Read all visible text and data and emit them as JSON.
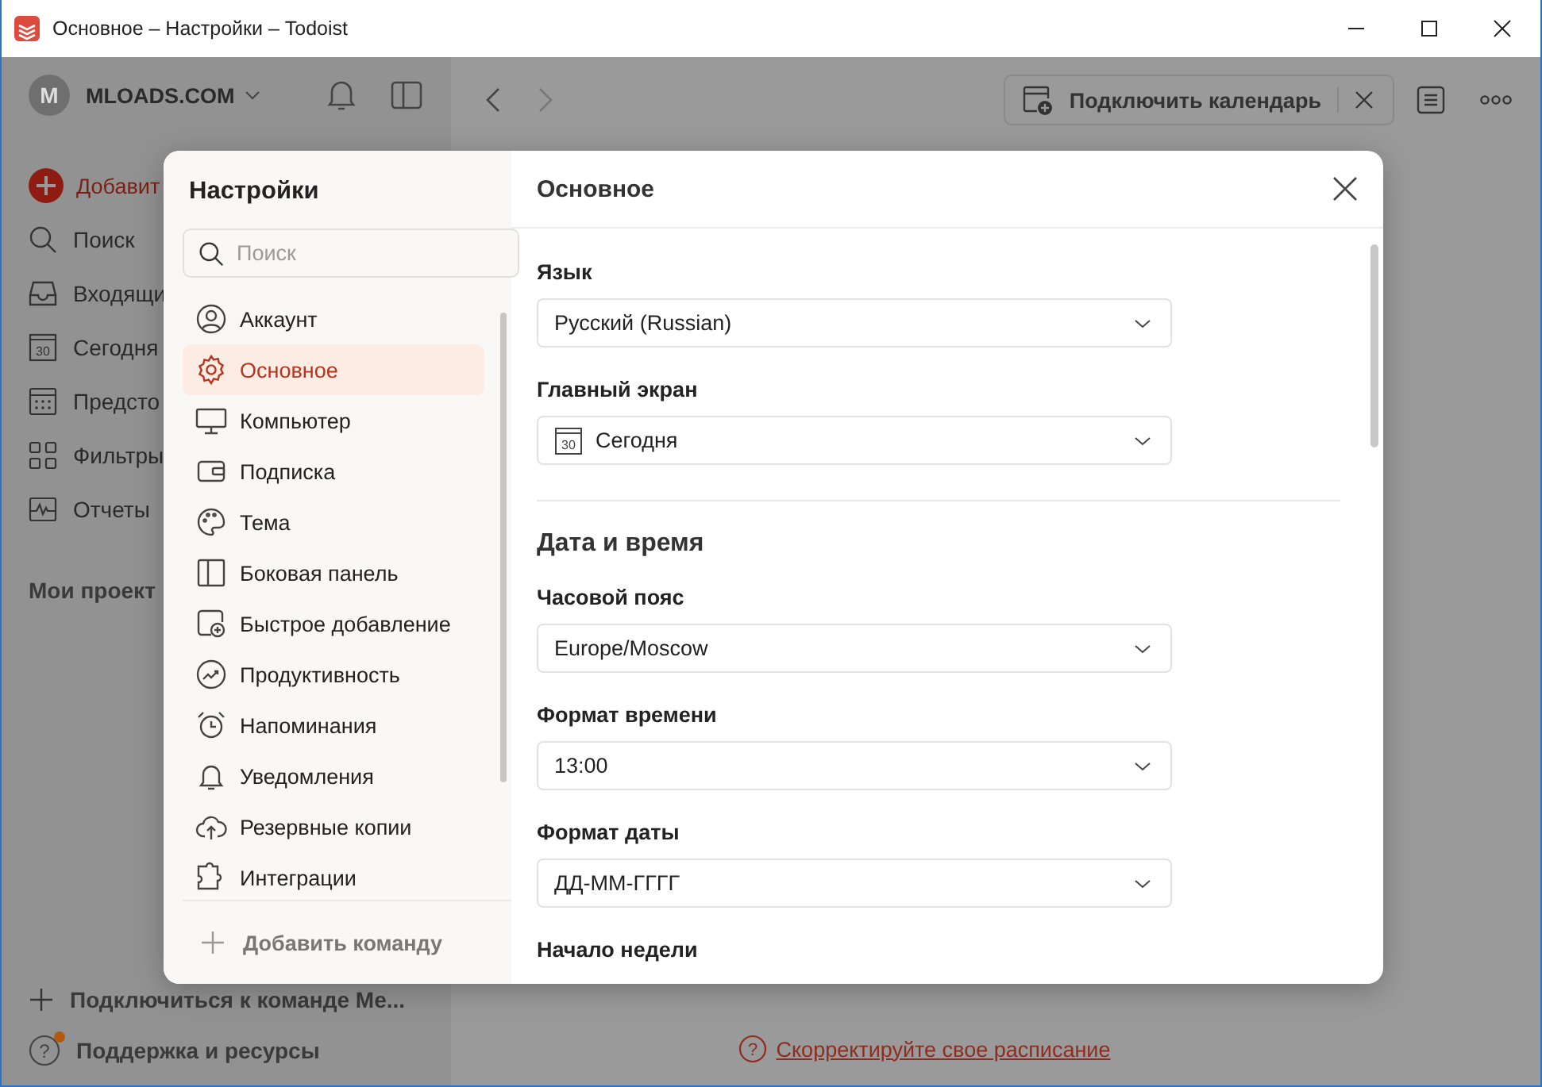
{
  "window": {
    "title": "Основное – Настройки – Todoist"
  },
  "sidebar": {
    "avatar": "M",
    "account": "MLOADS.COM",
    "add_task": "Добавит",
    "items": [
      {
        "label": "Поиск"
      },
      {
        "label": "Входящи"
      },
      {
        "label": "Сегодня",
        "icon_number": "30"
      },
      {
        "label": "Предсто"
      },
      {
        "label": "Фильтры"
      },
      {
        "label": "Отчеты"
      }
    ],
    "projects_heading": "Мои проект",
    "join_team": "Подключиться к команде Ме...",
    "help": {
      "icon_glyph": "?",
      "label": "Поддержка и ресурсы",
      "has_notification": true
    }
  },
  "toolbar": {
    "back_disabled": false,
    "forward_disabled": true,
    "connect_calendar": "Подключить календарь"
  },
  "footer": {
    "icon_glyph": "?",
    "link": "Скорректируйте свое расписание"
  },
  "settings": {
    "title": "Настройки",
    "search": {
      "placeholder": "Поиск"
    },
    "nav": [
      {
        "label": "Аккаунт",
        "selected": false
      },
      {
        "label": "Основное",
        "selected": true
      },
      {
        "label": "Компьютер",
        "selected": false
      },
      {
        "label": "Подписка",
        "selected": false
      },
      {
        "label": "Тема",
        "selected": false
      },
      {
        "label": "Боковая панель",
        "selected": false
      },
      {
        "label": "Быстрое добавление",
        "selected": false
      },
      {
        "label": "Продуктивность",
        "selected": false
      },
      {
        "label": "Напоминания",
        "selected": false
      },
      {
        "label": "Уведомления",
        "selected": false
      },
      {
        "label": "Резервные копии",
        "selected": false
      },
      {
        "label": "Интеграции",
        "selected": false
      }
    ],
    "add_team": "Добавить команду"
  },
  "panel": {
    "title": "Основное",
    "rows": [
      {
        "kind": "field",
        "label": "Язык",
        "value": "Русский (Russian)"
      },
      {
        "kind": "field",
        "label": "Главный экран",
        "value": "Сегодня",
        "icon_number": "30"
      },
      {
        "kind": "divider"
      },
      {
        "kind": "heading",
        "text": "Дата и время"
      },
      {
        "kind": "field",
        "label": "Часовой пояс",
        "value": "Europe/Moscow"
      },
      {
        "kind": "field",
        "label": "Формат времени",
        "value": "13:00"
      },
      {
        "kind": "field",
        "label": "Формат даты",
        "value": "ДД-ММ-ГГГГ"
      },
      {
        "kind": "label",
        "label": "Начало недели"
      }
    ]
  }
}
